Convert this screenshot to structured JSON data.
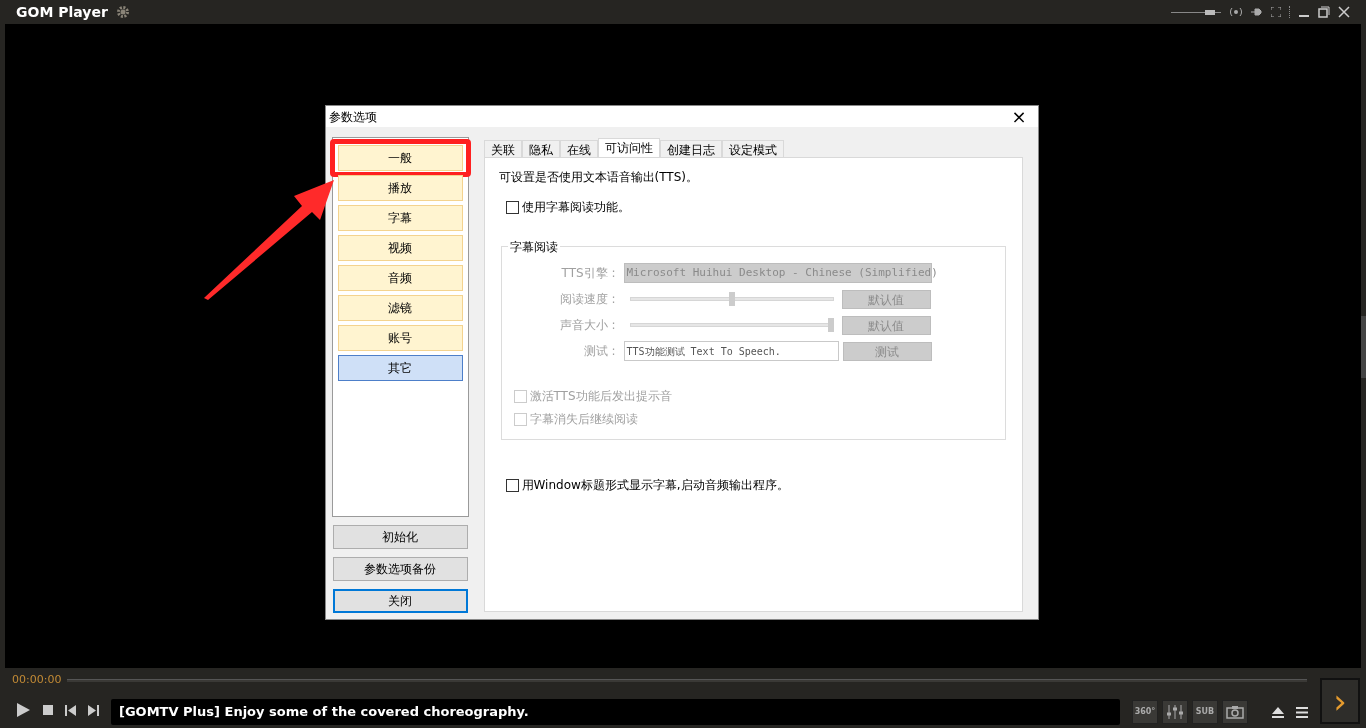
{
  "app": {
    "title": "GOM Player",
    "volume": {
      "level": 0.85
    }
  },
  "dialog": {
    "title": "参数选项",
    "close": "×",
    "sidebar": [
      {
        "label": "一般",
        "selected": false,
        "highlighted": true
      },
      {
        "label": "播放",
        "selected": false,
        "highlighted": false
      },
      {
        "label": "字幕",
        "selected": false,
        "highlighted": false
      },
      {
        "label": "视频",
        "selected": false,
        "highlighted": false
      },
      {
        "label": "音频",
        "selected": false,
        "highlighted": false
      },
      {
        "label": "滤镜",
        "selected": false,
        "highlighted": false
      },
      {
        "label": "账号",
        "selected": false,
        "highlighted": false
      },
      {
        "label": "其它",
        "selected": true,
        "highlighted": false
      }
    ],
    "buttons": [
      {
        "label": "初始化",
        "focused": false
      },
      {
        "label": "参数选项备份",
        "focused": false
      },
      {
        "label": "关闭",
        "focused": true
      }
    ],
    "tabs": [
      {
        "label": "关联",
        "selected": false
      },
      {
        "label": "隐私",
        "selected": false
      },
      {
        "label": "在线",
        "selected": false
      },
      {
        "label": "可访问性",
        "selected": true
      },
      {
        "label": "创建日志",
        "selected": false
      },
      {
        "label": "设定模式",
        "selected": false
      }
    ],
    "intro": "可设置是否使用文本语音输出(TTS)。",
    "use_reader": {
      "label": "使用字幕阅读功能。",
      "checked": false
    },
    "group": {
      "title": "字幕阅读",
      "disabled": true,
      "rows": [
        {
          "kind": "select",
          "label": "TTS引擎 :",
          "value": "Microsoft Huihui Desktop - Chinese (Simplified)"
        },
        {
          "kind": "slider",
          "label": "阅读速度 :",
          "level": 0.5,
          "button": "默认值"
        },
        {
          "kind": "slider",
          "label": "声音大小 :",
          "level": 1.0,
          "button": "默认值"
        },
        {
          "kind": "text",
          "label": "测试 :",
          "value": "TTS功能测试 Text To Speech.",
          "button": "测试"
        }
      ],
      "checks": [
        {
          "label": "激活TTS功能后发出提示音",
          "checked": false
        },
        {
          "label": "字幕消失后继续阅读",
          "checked": false
        }
      ]
    },
    "window_title_option": {
      "label": "用Window标题形式显示字幕,启动音频输出程序。",
      "checked": false
    }
  },
  "player": {
    "time": "00:00:00",
    "ticker": "[GOMTV Plus] Enjoy some of the covered choreography.",
    "tool_labels": [
      "360°",
      "SUB"
    ],
    "next": "›"
  }
}
